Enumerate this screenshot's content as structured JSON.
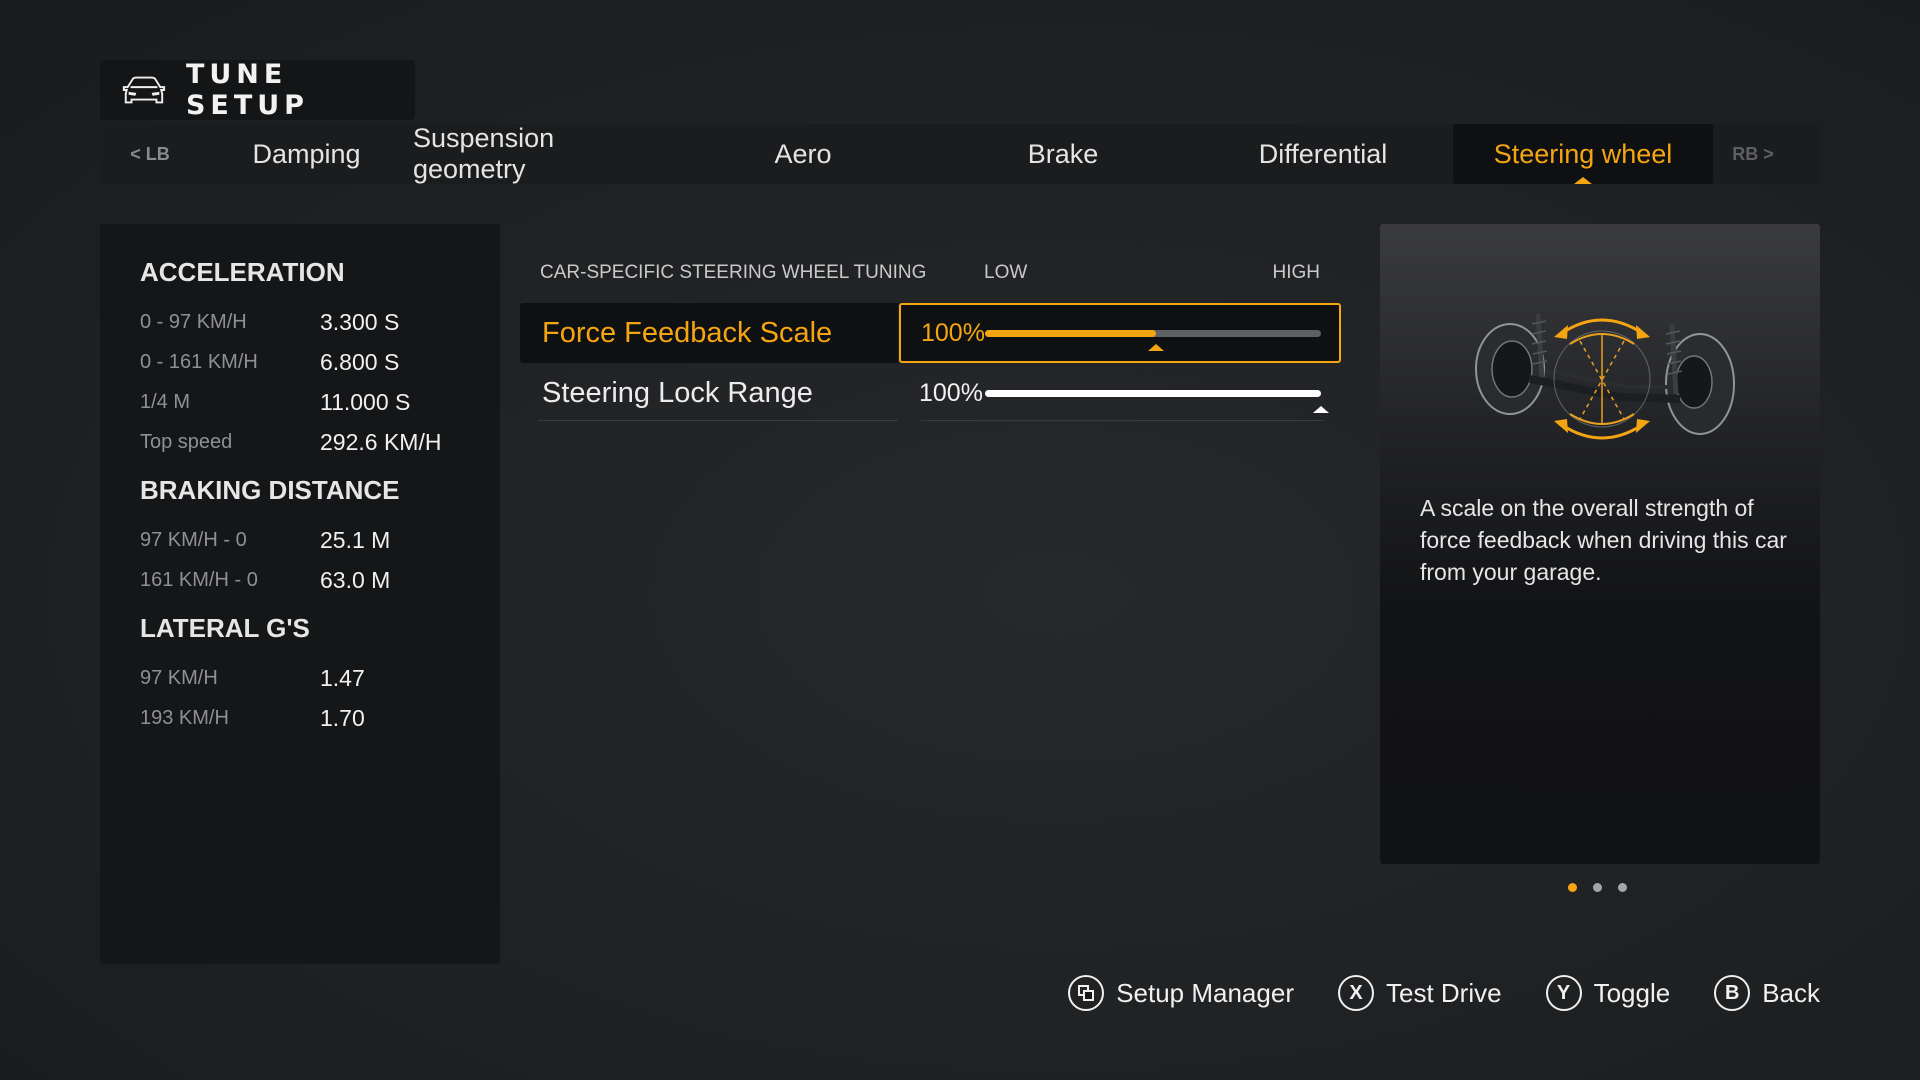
{
  "title": {
    "icon": "car-front-icon",
    "text": "TUNE SETUP"
  },
  "tabs": {
    "prev": "< LB",
    "next": "RB >",
    "items": [
      {
        "label": "Damping",
        "active": false
      },
      {
        "label": "Suspension geometry",
        "active": false
      },
      {
        "label": "Aero",
        "active": false
      },
      {
        "label": "Brake",
        "active": false
      },
      {
        "label": "Differential",
        "active": false
      },
      {
        "label": "Steering wheel",
        "active": true
      }
    ]
  },
  "stats": {
    "acceleration": {
      "heading": "ACCELERATION",
      "rows": [
        {
          "label": "0 - 97 KM/H",
          "value": "3.300 S"
        },
        {
          "label": "0 - 161 KM/H",
          "value": "6.800 S"
        },
        {
          "label": "1/4 M",
          "value": "11.000 S"
        },
        {
          "label": "Top speed",
          "value": "292.6 KM/H"
        }
      ]
    },
    "braking": {
      "heading": "BRAKING DISTANCE",
      "rows": [
        {
          "label": "97 KM/H - 0",
          "value": "25.1 M"
        },
        {
          "label": "161 KM/H - 0",
          "value": "63.0 M"
        }
      ]
    },
    "lateral": {
      "heading": "LATERAL G'S",
      "rows": [
        {
          "label": "97 KM/H",
          "value": "1.47"
        },
        {
          "label": "193 KM/H",
          "value": "1.70"
        }
      ]
    }
  },
  "settings": {
    "header": "CAR-SPECIFIC STEERING WHEEL TUNING",
    "low_label": "LOW",
    "high_label": "HIGH",
    "rows": [
      {
        "label": "Force Feedback Scale",
        "value": "100%",
        "fill_fraction": 0.51,
        "selected": true
      },
      {
        "label": "Steering Lock Range",
        "value": "100%",
        "fill_fraction": 1.0,
        "selected": false
      }
    ]
  },
  "info": {
    "image": "steering-suspension-illustration",
    "description": "A scale on the overall strength of force feedback when driving this car from your garage.",
    "page_count": 3,
    "active_page": 0
  },
  "footer": {
    "buttons": [
      {
        "glyph": "view-icon",
        "label": "Setup Manager"
      },
      {
        "glyph": "X",
        "label": "Test Drive"
      },
      {
        "glyph": "Y",
        "label": "Toggle"
      },
      {
        "glyph": "B",
        "label": "Back"
      }
    ]
  },
  "colors": {
    "accent": "#f5a511",
    "panel": "#151618",
    "text": "#e8e8e8",
    "muted": "#8f9092"
  }
}
